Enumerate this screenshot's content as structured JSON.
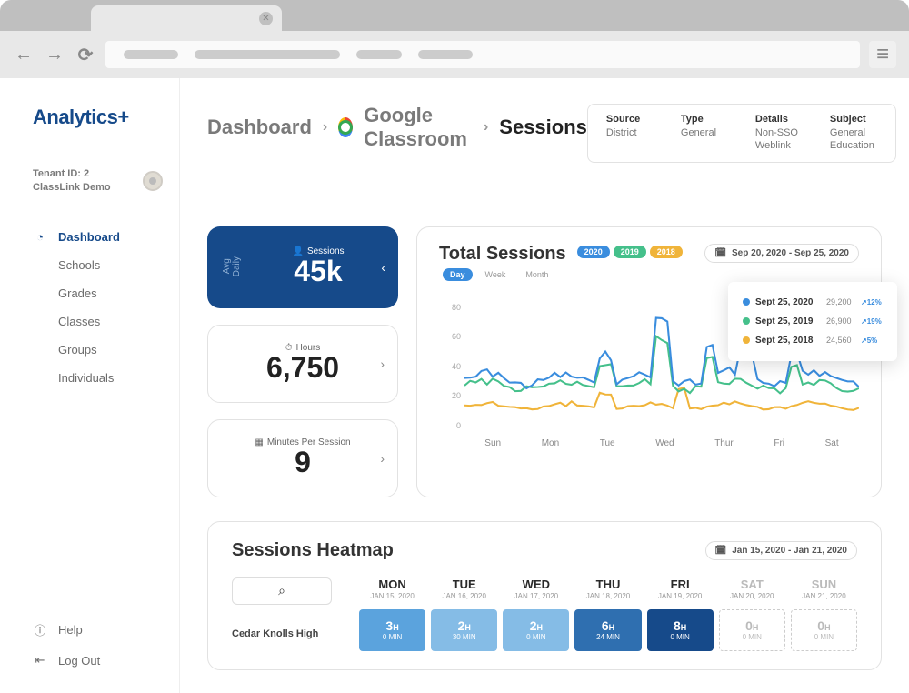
{
  "brand": "Analytics+",
  "tenant": {
    "line1": "Tenant ID: 2",
    "line2": "ClassLink Demo"
  },
  "nav": {
    "items": [
      {
        "label": "Dashboard",
        "active": true,
        "icon": "dashboard"
      },
      {
        "label": "Schools"
      },
      {
        "label": "Grades"
      },
      {
        "label": "Classes"
      },
      {
        "label": "Groups"
      },
      {
        "label": "Individuals"
      }
    ],
    "footer": [
      {
        "label": "Help",
        "icon": "info"
      },
      {
        "label": "Log Out",
        "icon": "logout"
      }
    ]
  },
  "breadcrumb": {
    "items": [
      "Dashboard",
      "Google Classroom",
      "Sessions"
    ]
  },
  "meta": [
    {
      "label": "Source",
      "value": "District"
    },
    {
      "label": "Type",
      "value": "General"
    },
    {
      "label": "Details",
      "value": "Non-SSO Weblink"
    },
    {
      "label": "Subject",
      "value": "General\nEducation"
    }
  ],
  "stats": {
    "avg_daily_label": "Avg\nDaily",
    "sessions": {
      "label": "Sessions",
      "value": "45k"
    },
    "hours": {
      "label": "Hours",
      "value": "6,750"
    },
    "mps": {
      "label": "Minutes Per Session",
      "value": "9"
    }
  },
  "chart": {
    "title": "Total Sessions",
    "years": [
      {
        "label": "2020",
        "color": "#3a8dde"
      },
      {
        "label": "2019",
        "color": "#45c08b"
      },
      {
        "label": "2018",
        "color": "#f0b43a"
      }
    ],
    "granularity": [
      "Day",
      "Week",
      "Month"
    ],
    "active_gran": "Day",
    "date_range": "Sep 20, 2020 - Sep 25, 2020",
    "y_ticks": [
      "80",
      "60",
      "40",
      "20",
      "0"
    ],
    "x_ticks": [
      "Sun",
      "Mon",
      "Tue",
      "Wed",
      "Thur",
      "Fri",
      "Sat"
    ],
    "tooltip": [
      {
        "date": "Sept 25, 2020",
        "value": "29,200",
        "delta": "12%",
        "color": "#3a8dde"
      },
      {
        "date": "Sept 25, 2019",
        "value": "26,900",
        "delta": "19%",
        "color": "#45c08b"
      },
      {
        "date": "Sept 25, 2018",
        "value": "24,560",
        "delta": "5%",
        "color": "#f0b43a"
      }
    ]
  },
  "heatmap": {
    "title": "Sessions Heatmap",
    "date_range": "Jan 15, 2020 - Jan 21, 2020",
    "school": "Cedar Knolls High",
    "days": [
      {
        "name": "MON",
        "date": "JAN 15, 2020",
        "hours": "3",
        "min": "0 MIN",
        "color": "#5ba3dd"
      },
      {
        "name": "TUE",
        "date": "JAN 16, 2020",
        "hours": "2",
        "min": "30 MIN",
        "color": "#85bce6"
      },
      {
        "name": "WED",
        "date": "JAN 17, 2020",
        "hours": "2",
        "min": "0 MIN",
        "color": "#85bce6"
      },
      {
        "name": "THU",
        "date": "JAN 18, 2020",
        "hours": "6",
        "min": "24 MIN",
        "color": "#2f6fb0"
      },
      {
        "name": "FRI",
        "date": "JAN 19, 2020",
        "hours": "8",
        "min": "0 MIN",
        "color": "#164a8a"
      },
      {
        "name": "SAT",
        "date": "JAN 20, 2020",
        "hours": "0",
        "min": "0 MIN",
        "empty": true
      },
      {
        "name": "SUN",
        "date": "JAN 21, 2020",
        "hours": "0",
        "min": "0 MIN",
        "empty": true
      }
    ]
  },
  "chart_data": {
    "type": "line",
    "title": "Total Sessions",
    "xlabel": "",
    "ylabel": "",
    "ylim": [
      0,
      80
    ],
    "categories": [
      "Sun",
      "Mon",
      "Tue",
      "Wed",
      "Thur",
      "Fri",
      "Sat"
    ],
    "series": [
      {
        "name": "2020",
        "color": "#3a8dde",
        "values": [
          32,
          34,
          45,
          75,
          55,
          40,
          32
        ]
      },
      {
        "name": "2019",
        "color": "#45c08b",
        "values": [
          28,
          30,
          40,
          58,
          48,
          35,
          28
        ]
      },
      {
        "name": "2018",
        "color": "#f0b43a",
        "values": [
          18,
          20,
          25,
          30,
          28,
          22,
          20
        ]
      }
    ]
  }
}
